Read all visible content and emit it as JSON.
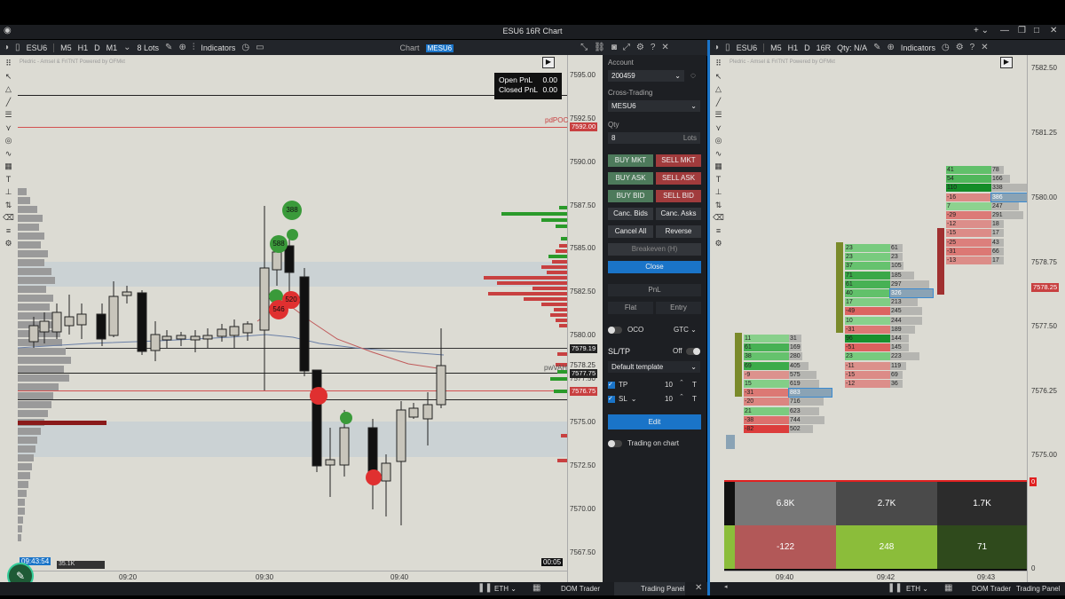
{
  "window": {
    "title": "ESU6 16R Chart"
  },
  "left_chart": {
    "symbol": "ESU6",
    "timeframes": [
      "M5",
      "H1",
      "D",
      "M1"
    ],
    "lots": "8 Lots",
    "indicators": "Indicators",
    "chart_label": "Chart",
    "chart_symbol": "MESU6",
    "watermark": "Pledric - Amsel & FriTNT Powered by OFMkt",
    "pnl": {
      "open_label": "Open PnL",
      "open_value": "0.00",
      "closed_label": "Closed PnL",
      "closed_value": "0.00"
    },
    "prices": [
      "7595.00",
      "7592.50",
      "7590.00",
      "7587.50",
      "7585.00",
      "7582.50",
      "7580.00",
      "7577.50",
      "7575.00",
      "7572.50",
      "7570.00",
      "7567.50"
    ],
    "tags": {
      "pdpoc_label": "pdPOC",
      "pdpoc_price": "7592.00",
      "p1": "7579.19",
      "pwvah_label": "pwVAH",
      "pwvah_price": "7578.25",
      "p2": "7577.75",
      "p3": "7576.75"
    },
    "times": [
      "09:20",
      "09:30",
      "09:40"
    ],
    "clock": "09:43:54",
    "volume": "35.1K",
    "countdown": "00:05",
    "bubbles": [
      "388",
      "588",
      "520",
      "546"
    ]
  },
  "panel": {
    "account_label": "Account",
    "account_value": "200459",
    "cross_label": "Cross-Trading",
    "cross_value": "MESU6",
    "qty_label": "Qty",
    "qty_value": "8",
    "qty_unit": "Lots",
    "buy_mkt": "BUY MKT",
    "sell_mkt": "SELL MKT",
    "buy_ask": "BUY ASK",
    "sell_ask": "SELL ASK",
    "buy_bid": "BUY BID",
    "sell_bid": "SELL BID",
    "canc_bids": "Canc. Bids",
    "canc_asks": "Canc. Asks",
    "cancel_all": "Cancel All",
    "reverse": "Reverse",
    "breakeven": "Breakeven (H)",
    "close": "Close",
    "pnl": "PnL",
    "flat": "Flat",
    "entry": "Entry",
    "oco": "OCO",
    "gtc": "GTC",
    "sltp": "SL/TP",
    "off": "Off",
    "template": "Default template",
    "tp_label": "TP",
    "tp_value": "10",
    "tp_unit": "T",
    "sl_label": "SL",
    "sl_value": "10",
    "sl_unit": "T",
    "edit": "Edit",
    "trading_on_chart": "Trading on chart"
  },
  "right_chart": {
    "symbol": "ESU6",
    "timeframes": [
      "M5",
      "H1",
      "D",
      "16R"
    ],
    "qty": "Qty: N/A",
    "indicators": "Indicators",
    "watermark": "Pledric - Amsel & FriTNT Powered by OFMkt",
    "prices": [
      "7582.50",
      "7581.25",
      "7580.00",
      "7578.75",
      "7577.50",
      "7576.25",
      "7575.00"
    ],
    "current_price": "7578.25",
    "zero_tag": "0",
    "times": [
      "09:40",
      "09:42",
      "09:43"
    ],
    "volumes": [
      "6.8K",
      "2.7K",
      "1.7K"
    ],
    "deltas": [
      "-122",
      "248",
      "71"
    ],
    "axis_zero": "0",
    "col1": [
      [
        "11",
        "31"
      ],
      [
        "61",
        "169"
      ],
      [
        "38",
        "280"
      ],
      [
        "69",
        "405"
      ],
      [
        "-9",
        "575"
      ],
      [
        "15",
        "619"
      ],
      [
        "-31",
        "883"
      ],
      [
        "-20",
        "716"
      ],
      [
        "21",
        "623"
      ],
      [
        "-38",
        "744"
      ],
      [
        "-82",
        "502"
      ]
    ],
    "col2": [
      [
        "23",
        "61"
      ],
      [
        "23",
        "23"
      ],
      [
        "37",
        "105"
      ],
      [
        "71",
        "185"
      ],
      [
        "61",
        "297"
      ],
      [
        "40",
        "326"
      ],
      [
        "17",
        "213"
      ],
      [
        "-49",
        "245"
      ],
      [
        "10",
        "244"
      ],
      [
        "-31",
        "189"
      ],
      [
        "96",
        "144"
      ],
      [
        "-51",
        "145"
      ],
      [
        "23",
        "223"
      ],
      [
        "-11",
        "119"
      ],
      [
        "-15",
        "69"
      ],
      [
        "-12",
        "36"
      ]
    ],
    "col3": [
      [
        "41",
        "78"
      ],
      [
        "54",
        "166"
      ],
      [
        "110",
        "338"
      ],
      [
        "-16",
        "386"
      ],
      [
        "7",
        "247"
      ],
      [
        "-29",
        "291"
      ],
      [
        "-12",
        "18"
      ],
      [
        "-15",
        "17"
      ],
      [
        "-25",
        "43"
      ],
      [
        "-31",
        "66"
      ],
      [
        "-13",
        "17"
      ]
    ]
  },
  "bottom": {
    "eth_left": "ETH",
    "dom_left": "DOM Trader",
    "tp_left": "Trading Panel",
    "eth_right": "ETH",
    "dom_right": "DOM Trader",
    "tp_right": "Trading Panel"
  }
}
